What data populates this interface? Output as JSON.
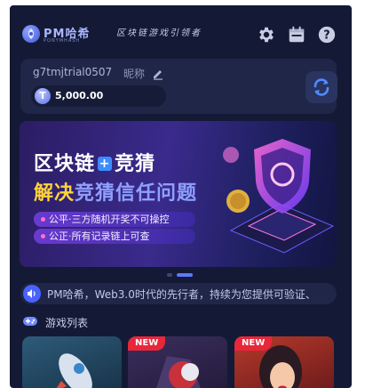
{
  "header": {
    "logo_text": "PM哈希",
    "logo_sub": "PONYMHASH",
    "slogan": "区块链游戏引领者",
    "icons": [
      "gear-icon",
      "calendar-icon",
      "help-icon"
    ]
  },
  "account": {
    "user_id": "g7tmjtrial0507",
    "nickname_label": "昵称",
    "balance": "5,000.00",
    "coin_symbol": "T"
  },
  "banner": {
    "title_a": "区块链",
    "title_plus": "+",
    "title_b": "竞猜",
    "subtitle_a": "解决",
    "subtitle_b": "竞猜信任问题",
    "bullets": [
      "公平·三方随机开奖不可操控",
      "公正·所有记录链上可查"
    ]
  },
  "notice": {
    "text": "PM哈希，Web3.0时代的先行者，持续为您提供可验证、"
  },
  "games": {
    "title": "游戏列表",
    "new_label": "NEW",
    "cards": [
      {
        "new": false
      },
      {
        "new": true
      },
      {
        "new": true
      }
    ]
  },
  "colors": {
    "background": "#141a35",
    "card": "#1f2647",
    "accent": "#4a63ff",
    "new_badge": "#e8273a",
    "gold": "#ffd23a"
  }
}
